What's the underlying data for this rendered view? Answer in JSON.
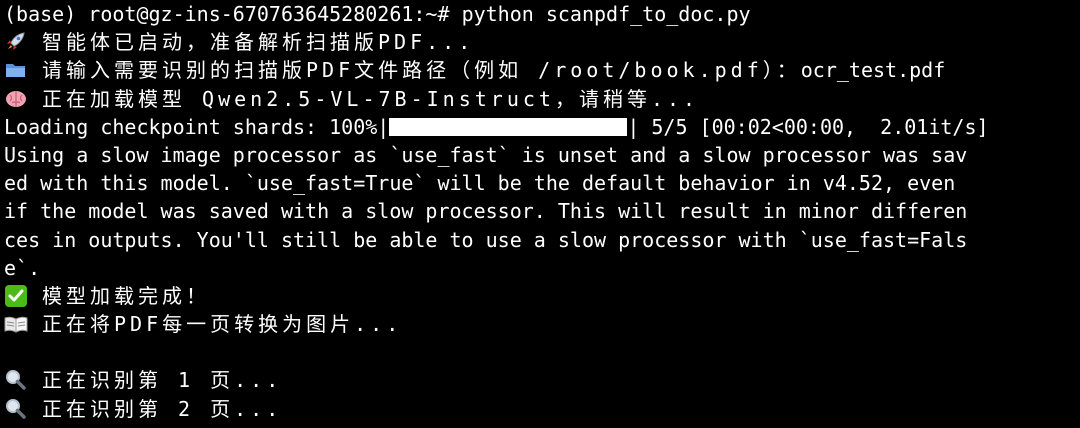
{
  "terminal": {
    "prompt": "(base) root@gz-ins-670763645280261:~# ",
    "command": "python scanpdf_to_doc.py",
    "started": "智能体已启动，准备解析扫描版PDF...",
    "input_prompt": "请输入需要识别的扫描版PDF文件路径（例如 /root/book.pdf）：",
    "input_value": "ocr_test.pdf",
    "loading_model": "正在加载模型 Qwen2.5-VL-7B-Instruct，请稍等...",
    "checkpoint_prefix": "Loading checkpoint shards: 100%|",
    "checkpoint_progress": 1.0,
    "checkpoint_suffix": "| 5/5 [00:02<00:00,  2.01it/s]",
    "warning_lines": [
      "Using a slow image processor as `use_fast` is unset and a slow processor was sav",
      "ed with this model. `use_fast=True` will be the default behavior in v4.52, even",
      "if the model was saved with a slow processor. This will result in minor differen",
      "ces in outputs. You'll still be able to use a slow processor with `use_fast=Fals",
      "e`."
    ],
    "model_loaded": "模型加载完成！",
    "converting": "正在将PDF每一页转换为图片...",
    "recognizing_1": "正在识别第 1 页...",
    "recognizing_2": "正在识别第 2 页..."
  },
  "icons": {
    "started": "rocket-icon",
    "input": "folder-icon",
    "loading": "brain-icon",
    "loaded": "check-mark-icon",
    "converting": "book-icon",
    "recognizing": "magnifier-icon"
  },
  "colors": {
    "background": "#000000",
    "text": "#ffffff",
    "check_green": "#4cbb17"
  }
}
